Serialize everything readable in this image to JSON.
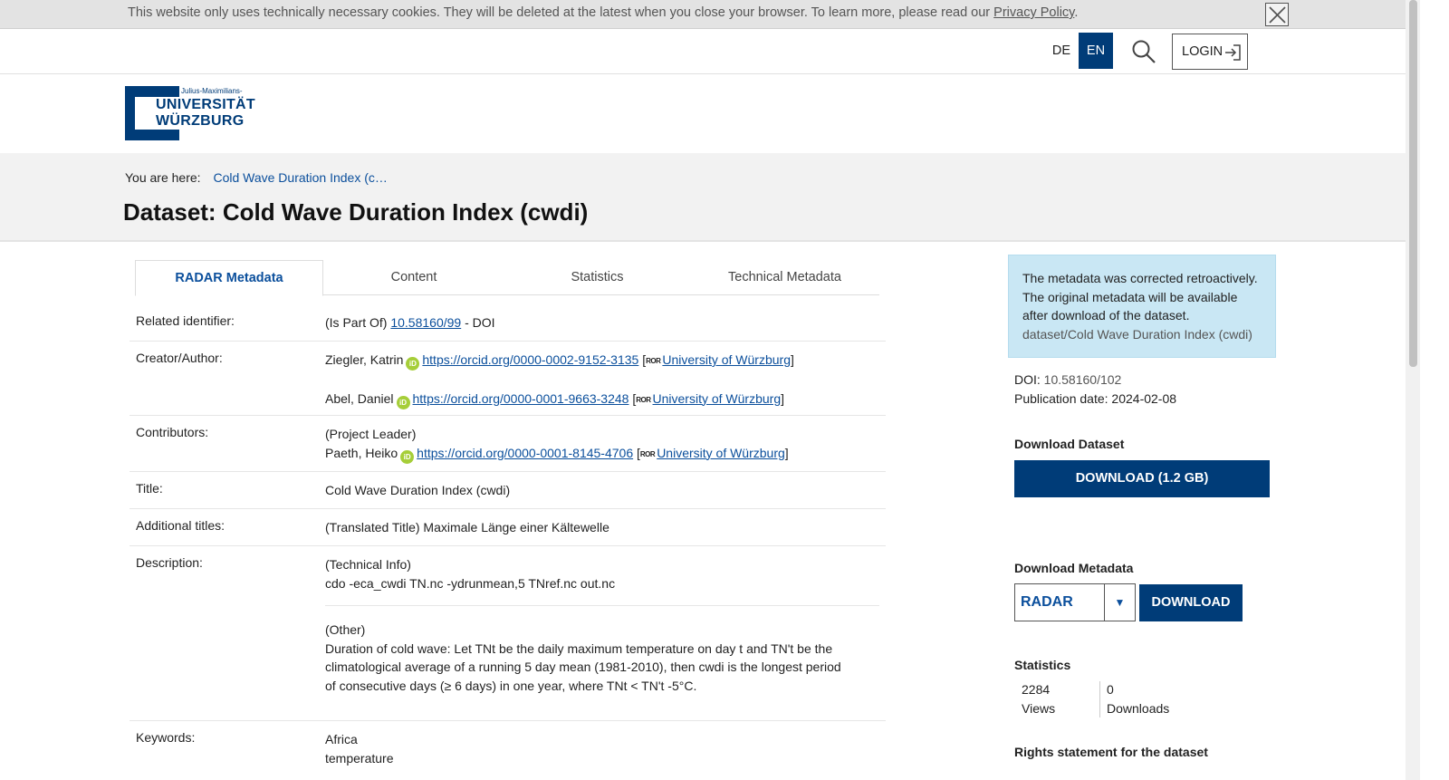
{
  "cookie": {
    "text": "This website only uses technically necessary cookies. They will be deleted at the latest when you close your browser. To learn more, please read our ",
    "link": "Privacy Policy",
    "suffix": "."
  },
  "header": {
    "lang_de": "DE",
    "lang_en": "EN",
    "login_label": "LOGIN",
    "icons": {
      "search": "search-icon",
      "login": "login-arrow-icon",
      "close": "close-icon"
    }
  },
  "logo": {
    "small": "Julius-Maximilians-",
    "line1": "UNIVERSITÄT",
    "line2": "WÜRZBURG"
  },
  "breadcrumb": {
    "label": "You are here:",
    "link": "Cold Wave Duration Index (c…"
  },
  "page": {
    "title": "Dataset: Cold Wave Duration Index (cwdi)"
  },
  "tabs": [
    {
      "label": "RADAR Metadata",
      "active": true
    },
    {
      "label": "Content",
      "active": false
    },
    {
      "label": "Statistics",
      "active": false
    },
    {
      "label": "Technical Metadata",
      "active": false
    }
  ],
  "metadata": {
    "related": {
      "label": "Related identifier:",
      "prefix": "(Is Part Of) ",
      "link": "10.58160/99",
      "suffix": " - DOI"
    },
    "creators": {
      "label": "Creator/Author:",
      "people": [
        {
          "name": "Ziegler, Katrin",
          "orcid": "https://orcid.org/0000-0002-9152-3135",
          "affiliation": "University of Würzburg"
        },
        {
          "name": "Abel, Daniel",
          "orcid": "https://orcid.org/0000-0001-9663-3248",
          "affiliation": "University of Würzburg"
        }
      ]
    },
    "contributors": {
      "label": "Contributors:",
      "role": "(Project Leader)",
      "name": "Paeth, Heiko",
      "orcid": "https://orcid.org/0000-0001-8145-4706",
      "affiliation": "University of Würzburg"
    },
    "title": {
      "label": "Title:",
      "value": "Cold Wave Duration Index (cwdi)"
    },
    "additional_titles": {
      "label": "Additional titles:",
      "value": "(Translated Title) Maximale Länge einer Kältewelle"
    },
    "description": {
      "label": "Description:",
      "tech_heading": "(Technical Info)",
      "tech_text": "cdo -eca_cwdi TN.nc -ydrunmean,5 TNref.nc out.nc",
      "other_heading": "(Other)",
      "other_text": "Duration of cold wave: Let TNt be the daily maximum temperature on day t and TN't be the climatological average of a running 5 day mean (1981-2010), then cwdi is the longest period of consecutive days (≥ 6 days) in one year, where TNt < TN't -5°C."
    },
    "keywords": {
      "label": "Keywords:",
      "items": [
        "Africa",
        "temperature"
      ]
    },
    "orcid_badge": "iD",
    "ror_badge": "ROR"
  },
  "sidebar": {
    "notice": {
      "text": "The metadata was corrected retroactively. The original metadata will be available after download of the dataset.",
      "path": "dataset/Cold Wave Duration Index (cwdi)"
    },
    "doi_label": "DOI:",
    "doi_value": "10.58160/102",
    "pubdate_label": "Publication date:",
    "pubdate_value": "2024-02-08",
    "download_dataset_heading": "Download Dataset",
    "download_dataset_button": "DOWNLOAD (1.2 GB)",
    "download_metadata_heading": "Download Metadata",
    "metadata_format": "RADAR",
    "metadata_download_button": "DOWNLOAD",
    "statistics_heading": "Statistics",
    "views_count": "2284",
    "views_label": "Views",
    "downloads_count": "0",
    "downloads_label": "Downloads",
    "rights_heading": "Rights statement for the dataset"
  },
  "colors": {
    "brand": "#003c78",
    "link": "#0b4f9c",
    "orcid": "#a6ce39",
    "notice_bg": "#c9e7f4"
  }
}
